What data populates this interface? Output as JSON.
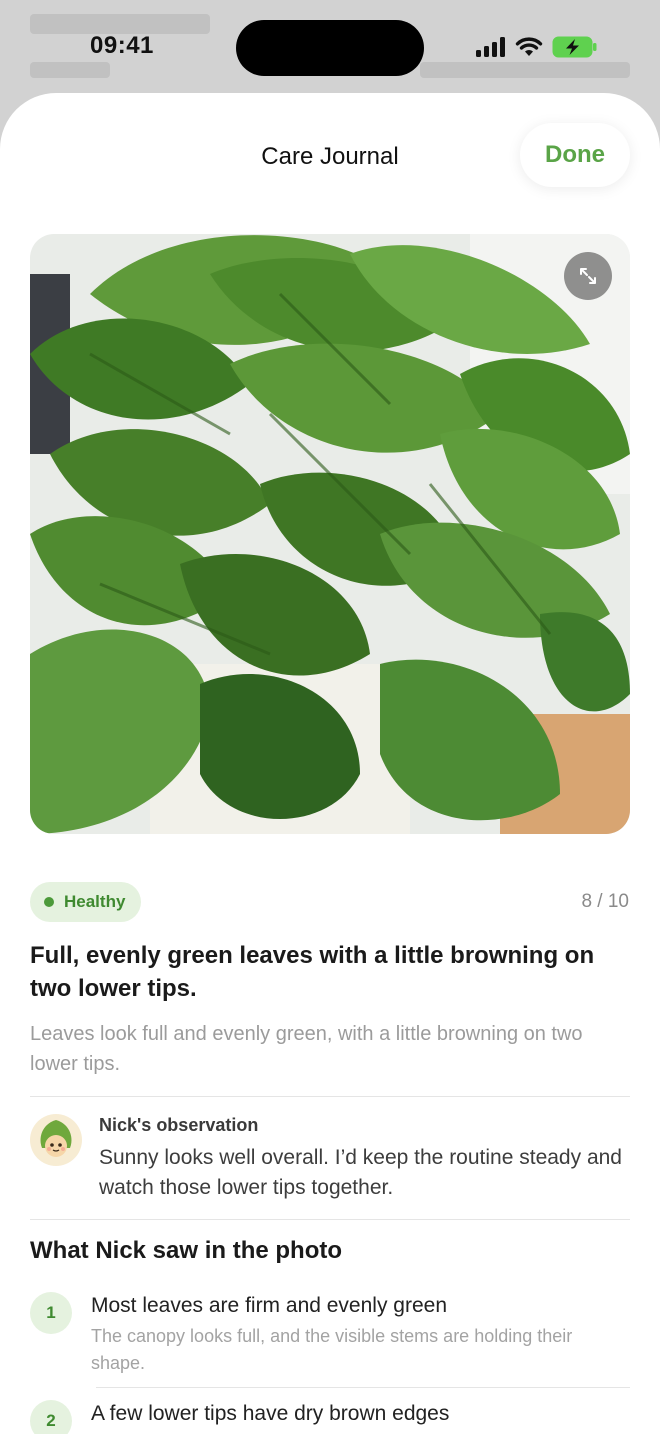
{
  "status_bar": {
    "time": "09:41"
  },
  "sheet": {
    "title": "Care Journal",
    "done_label": "Done"
  },
  "photo": {
    "expand_icon": "expand-arrows-icon"
  },
  "assessment": {
    "badge_label": "Healthy",
    "score": "8 / 10",
    "headline": "Full, evenly green leaves with a little browning on two lower tips.",
    "summary": "Leaves look full and evenly green, with a little browning on two lower tips."
  },
  "observation": {
    "label": "Nick's observation",
    "text": "Sunny looks well overall. I’d keep the routine steady and watch those lower tips together."
  },
  "findings": {
    "title": "What Nick saw in the photo",
    "items": [
      {
        "number": "1",
        "title": "Most leaves are firm and evenly green",
        "description": "The canopy looks full, and the visible stems are holding their shape."
      },
      {
        "number": "2",
        "title": "A few lower tips have dry brown edges",
        "description": ""
      }
    ]
  },
  "colors": {
    "accent": "#5aa447",
    "badge_bg": "#e5f2df",
    "badge_text": "#3f8a30"
  }
}
